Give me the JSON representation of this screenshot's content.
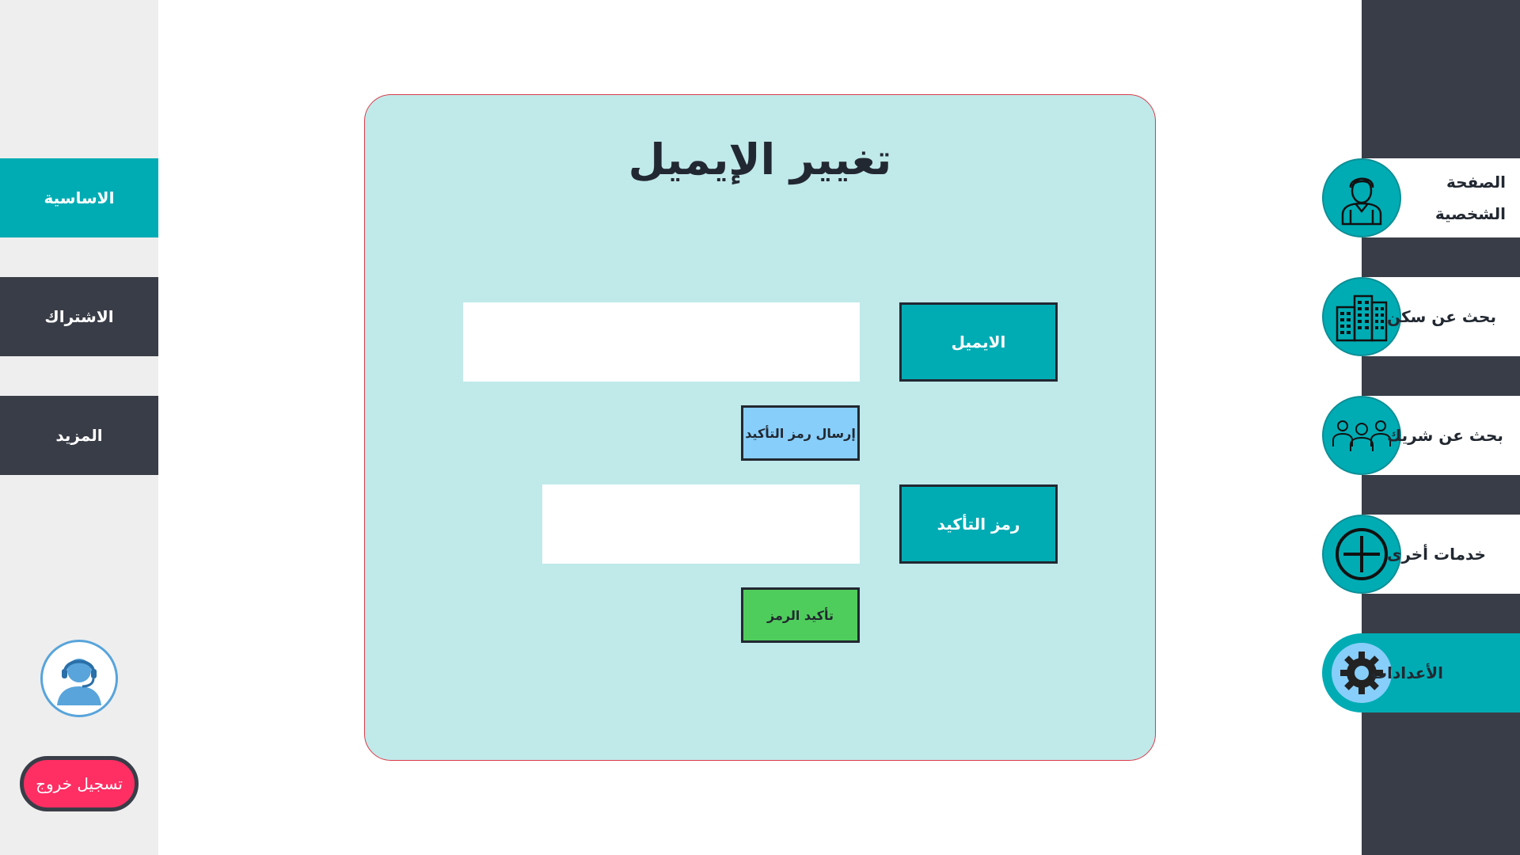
{
  "left_sidebar": {
    "items": [
      {
        "label": "الاساسية",
        "active": true
      },
      {
        "label": "الاشتراك",
        "active": false
      },
      {
        "label": "المزيد",
        "active": false
      }
    ],
    "logout_label": "تسجيل خروج"
  },
  "right_sidebar": {
    "items": [
      {
        "label": "الصفحة الشخصية",
        "icon": "user-icon",
        "active": false
      },
      {
        "label": "بحث عن سكن",
        "icon": "building-icon",
        "active": false
      },
      {
        "label": "بحث عن شريك",
        "icon": "group-icon",
        "active": false
      },
      {
        "label": "خدمات أخرى",
        "icon": "plus-circle-icon",
        "active": false
      },
      {
        "label": "الأعدادات",
        "icon": "gear-icon",
        "active": true
      }
    ]
  },
  "card": {
    "title": "تغيير الإيميل",
    "email_label": "الايميل",
    "email_value": "",
    "send_code_label": "إرسال رمز التأكيد",
    "code_label": "رمز التأكيد",
    "code_value": "",
    "confirm_code_label": "تأكيد الرمز"
  },
  "colors": {
    "accent": "#00acb4",
    "sidebar_dark": "#393d47",
    "card_bg": "#c0e9ea",
    "send_button": "#87cefa",
    "confirm_button": "#4fcd5c",
    "logout": "#ff2e63"
  }
}
